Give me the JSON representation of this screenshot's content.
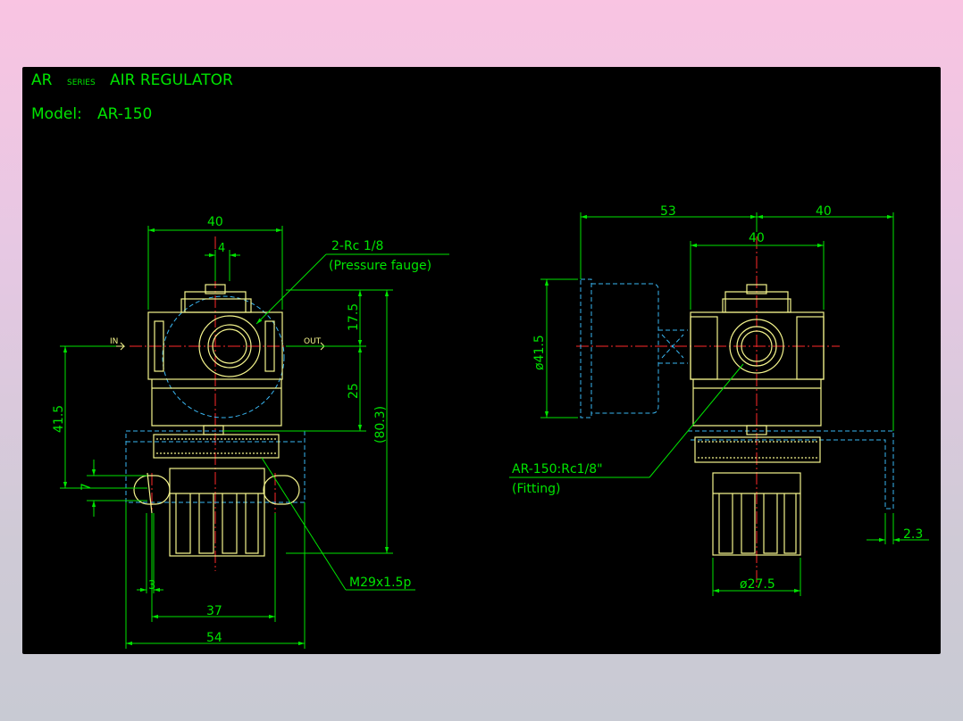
{
  "header": {
    "series_prefix": "AR",
    "series_word": "SERIES",
    "series_name": "AIR REGULATOR",
    "model_label": "Model:",
    "model_value": "AR-150"
  },
  "front_view": {
    "dim_body_width": "40",
    "dim_port_width": "4",
    "gauge_port_label": "2-Rc 1/8",
    "gauge_port_note": "(Pressure fauge)",
    "in_label": "IN",
    "out_label": "OUT",
    "dim_upper_height": "17.5",
    "dim_lower_height": "25",
    "dim_total_height": "(80.3)",
    "dim_mount_height": "41.5",
    "dim_small_height": "7",
    "dim_small_width": "3",
    "dim_bolt_pitch": "37",
    "dim_bracket_width": "54",
    "thread_label": "M29x1.5p"
  },
  "side_view": {
    "dim_gauge_offset": "53",
    "dim_right_offset": "40",
    "dim_body_width": "40",
    "dim_gauge_dia": "ø41.5",
    "fitting_label": "AR-150:Rc1/8\"",
    "fitting_note": "(Fitting)",
    "dim_bracket_thickness": "2.3",
    "dim_knob_dia": "ø27.5"
  },
  "colors": {
    "background": "#000000",
    "dimension": "#00e400",
    "outline": "#f4f48c",
    "hidden": "#39b6f2",
    "center": "#ff2a2a",
    "text": "#00e400"
  }
}
